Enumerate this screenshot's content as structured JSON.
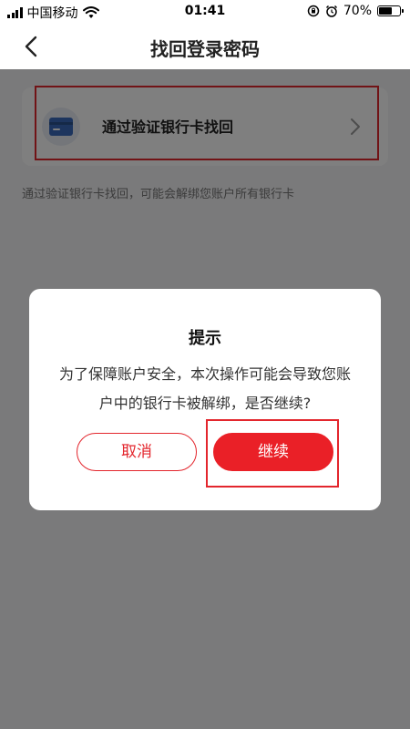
{
  "status_bar": {
    "carrier": "中国移动",
    "time": "01:41",
    "battery_percent": "70%",
    "battery_level": 0.7,
    "wifi_icon": "wifi-icon",
    "lock_icon": "orientation-lock-icon",
    "alarm_icon": "alarm-icon"
  },
  "nav": {
    "title": "找回登录密码",
    "back_icon": "chevron-left-icon"
  },
  "option": {
    "label": "通过验证银行卡找回",
    "icon": "bank-card-icon",
    "chevron_icon": "chevron-right-icon"
  },
  "hint": "通过验证银行卡找回，可能会解绑您账户所有银行卡",
  "dialog": {
    "title": "提示",
    "message": "为了保障账户安全，本次操作可能会导致您账户中的银行卡被解绑，是否继续?",
    "cancel_label": "取消",
    "continue_label": "继续"
  },
  "colors": {
    "accent": "#ea2027",
    "highlight": "#e3262d",
    "overlay": "rgba(0,0,0,0.5)"
  }
}
